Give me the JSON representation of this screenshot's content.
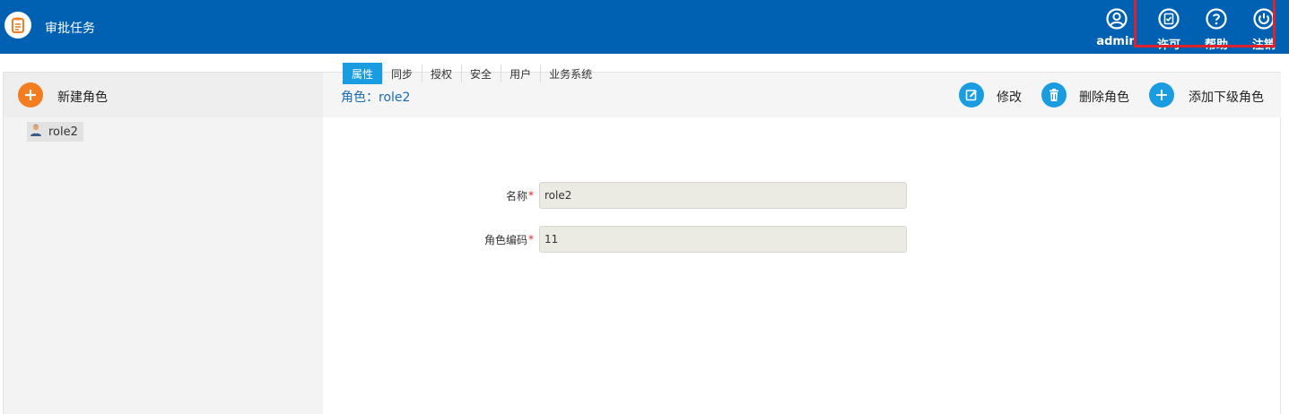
{
  "app": {
    "title": "审批任务"
  },
  "topbar": {
    "actions": [
      {
        "label": "admin",
        "icon": "user-circle-icon"
      },
      {
        "label": "许可",
        "icon": "clipboard-check-icon"
      },
      {
        "label": "帮助",
        "icon": "help-circle-icon"
      },
      {
        "label": "注销",
        "icon": "power-icon"
      }
    ]
  },
  "sidebar": {
    "new_role_label": "新建角色",
    "tree": [
      {
        "label": "role2",
        "icon": "user-avatar-icon"
      }
    ]
  },
  "main": {
    "role_title": "角色：role2",
    "actions": {
      "edit_label": "修改",
      "delete_label": "删除角色",
      "add_child_label": "添加下级角色"
    },
    "tabs": [
      {
        "label": "属性",
        "active": true
      },
      {
        "label": "同步",
        "active": false
      },
      {
        "label": "授权",
        "active": false
      },
      {
        "label": "安全",
        "active": false
      },
      {
        "label": "用户",
        "active": false
      },
      {
        "label": "业务系统",
        "active": false
      }
    ],
    "form": {
      "name": {
        "label": "名称",
        "required_mark": "*",
        "value": "role2"
      },
      "code": {
        "label": "角色编码",
        "required_mark": "*",
        "value": "11"
      }
    }
  },
  "colors": {
    "topbar": "#0061b2",
    "accent_blue": "#1a9ce0",
    "accent_orange": "#f47d20",
    "highlight_red": "#e0202a"
  }
}
